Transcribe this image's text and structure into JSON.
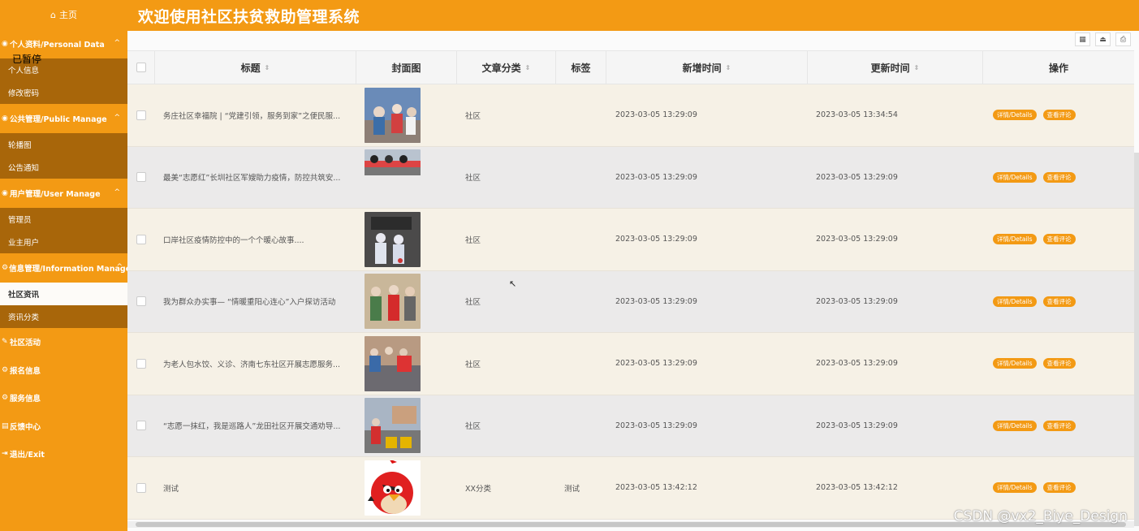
{
  "sidebar": {
    "home_label": "主页",
    "paused_label": "已暂停",
    "groups": [
      {
        "label": "个人资料/Personal Data",
        "items": [
          "个人信息",
          "修改密码"
        ]
      },
      {
        "label": "公共管理/Public Manage",
        "items": [
          "轮播图",
          "公告通知"
        ]
      },
      {
        "label": "用户管理/User Manage",
        "items": [
          "管理员",
          "业主用户"
        ]
      },
      {
        "label": "信息管理/Information Manage",
        "items": [
          "社区资讯",
          "资讯分类"
        ]
      }
    ],
    "singles": [
      "社区活动",
      "报名信息",
      "服务信息",
      "反馈中心",
      "退出/Exit"
    ],
    "chevron": "^"
  },
  "header": {
    "title": "欢迎使用社区扶贫救助管理系统"
  },
  "toolbar": {
    "icons": [
      "grid-icon",
      "export-icon",
      "print-icon"
    ]
  },
  "table": {
    "columns": [
      "标题",
      "封面图",
      "文章分类",
      "标签",
      "新增时间",
      "更新时间",
      "操作"
    ],
    "rows": [
      {
        "title": "务庄社区幸福院 | “党建引领，服务到家”之便民服...",
        "category": "社区",
        "tag": "",
        "created": "2023-03-05 13:29:09",
        "updated": "2023-03-05 13:34:54",
        "cover": "photo-1"
      },
      {
        "title": "最美“志愿红”长圳社区军嫂助力疫情，防控共筑安...",
        "category": "社区",
        "tag": "",
        "created": "2023-03-05 13:29:09",
        "updated": "2023-03-05 13:29:09",
        "cover": "photo-2"
      },
      {
        "title": "口岸社区疫情防控中的一个个暖心故事....",
        "category": "社区",
        "tag": "",
        "created": "2023-03-05 13:29:09",
        "updated": "2023-03-05 13:29:09",
        "cover": "photo-3"
      },
      {
        "title": "我为群众办实事— “情暖重阳心连心”入户探访活动",
        "category": "社区",
        "tag": "",
        "created": "2023-03-05 13:29:09",
        "updated": "2023-03-05 13:29:09",
        "cover": "photo-4"
      },
      {
        "title": "为老人包水饺、义诊、济南七东社区开展志愿服务...",
        "category": "社区",
        "tag": "",
        "created": "2023-03-05 13:29:09",
        "updated": "2023-03-05 13:29:09",
        "cover": "photo-5"
      },
      {
        "title": "“志愿一抹红，我是巡路人”龙田社区开展交通劝导...",
        "category": "社区",
        "tag": "",
        "created": "2023-03-05 13:29:09",
        "updated": "2023-03-05 13:29:09",
        "cover": "photo-6"
      },
      {
        "title": "测试",
        "category": "XX分类",
        "tag": "测试",
        "created": "2023-03-05 13:42:12",
        "updated": "2023-03-05 13:42:12",
        "cover": "red-bird"
      }
    ],
    "detail_label": "详情/Details",
    "comment_label": "查看评论"
  },
  "watermark": "CSDN @vx2_Biye_Design",
  "colors": {
    "accent": "#f39a14",
    "submenu": "#a8660a",
    "row_odd": "#f6f1e6",
    "row_even": "#ebeaea"
  }
}
